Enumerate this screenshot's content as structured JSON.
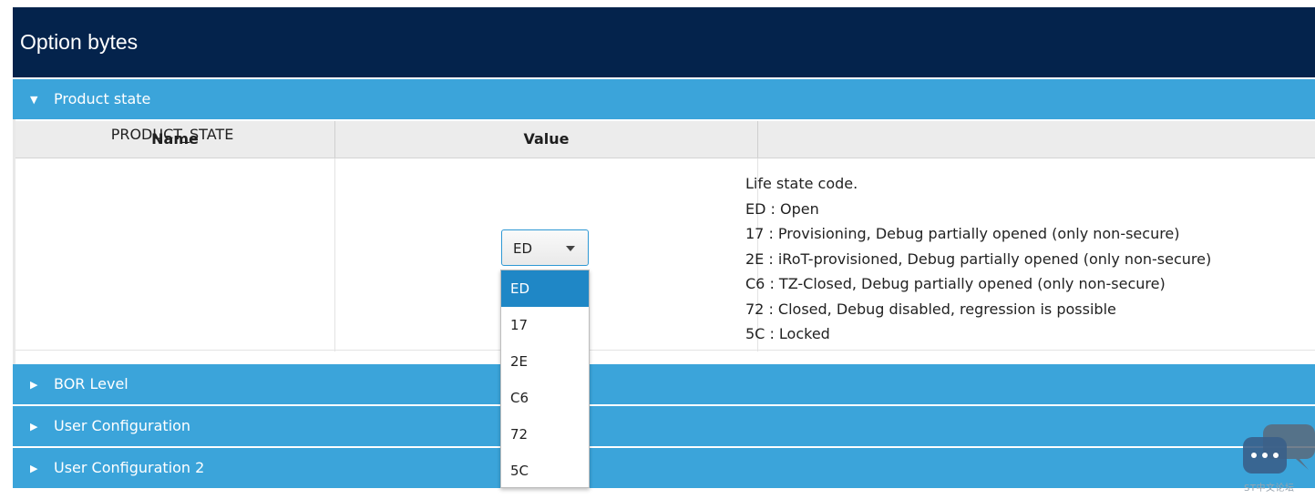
{
  "header": {
    "title": "Option bytes"
  },
  "sections": [
    {
      "label": "Product state",
      "expanded": true
    },
    {
      "label": "BOR Level",
      "expanded": false
    },
    {
      "label": "User Configuration",
      "expanded": false
    },
    {
      "label": "User Configuration 2",
      "expanded": false
    }
  ],
  "table": {
    "columns": [
      "Name",
      "Value",
      ""
    ],
    "row": {
      "name": "PRODUCT_STATE",
      "value": "ED",
      "description": [
        "Life state code.",
        "ED : Open",
        "17 : Provisioning, Debug partially opened (only non-secure)",
        "2E : iRoT-provisioned, Debug partially opened (only non-secure)",
        "C6 : TZ-Closed, Debug partially opened (only non-secure)",
        "72 : Closed, Debug disabled, regression is possible",
        "5C : Locked"
      ]
    }
  },
  "dropdown": {
    "options": [
      "ED",
      "17",
      "2E",
      "C6",
      "72",
      "5C"
    ],
    "selected": "ED"
  },
  "watermark": {
    "text": "ST中文论坛"
  },
  "colors": {
    "header_bg": "#04234c",
    "section_bg": "#3ba4da",
    "selected_option": "#1f87c6"
  }
}
